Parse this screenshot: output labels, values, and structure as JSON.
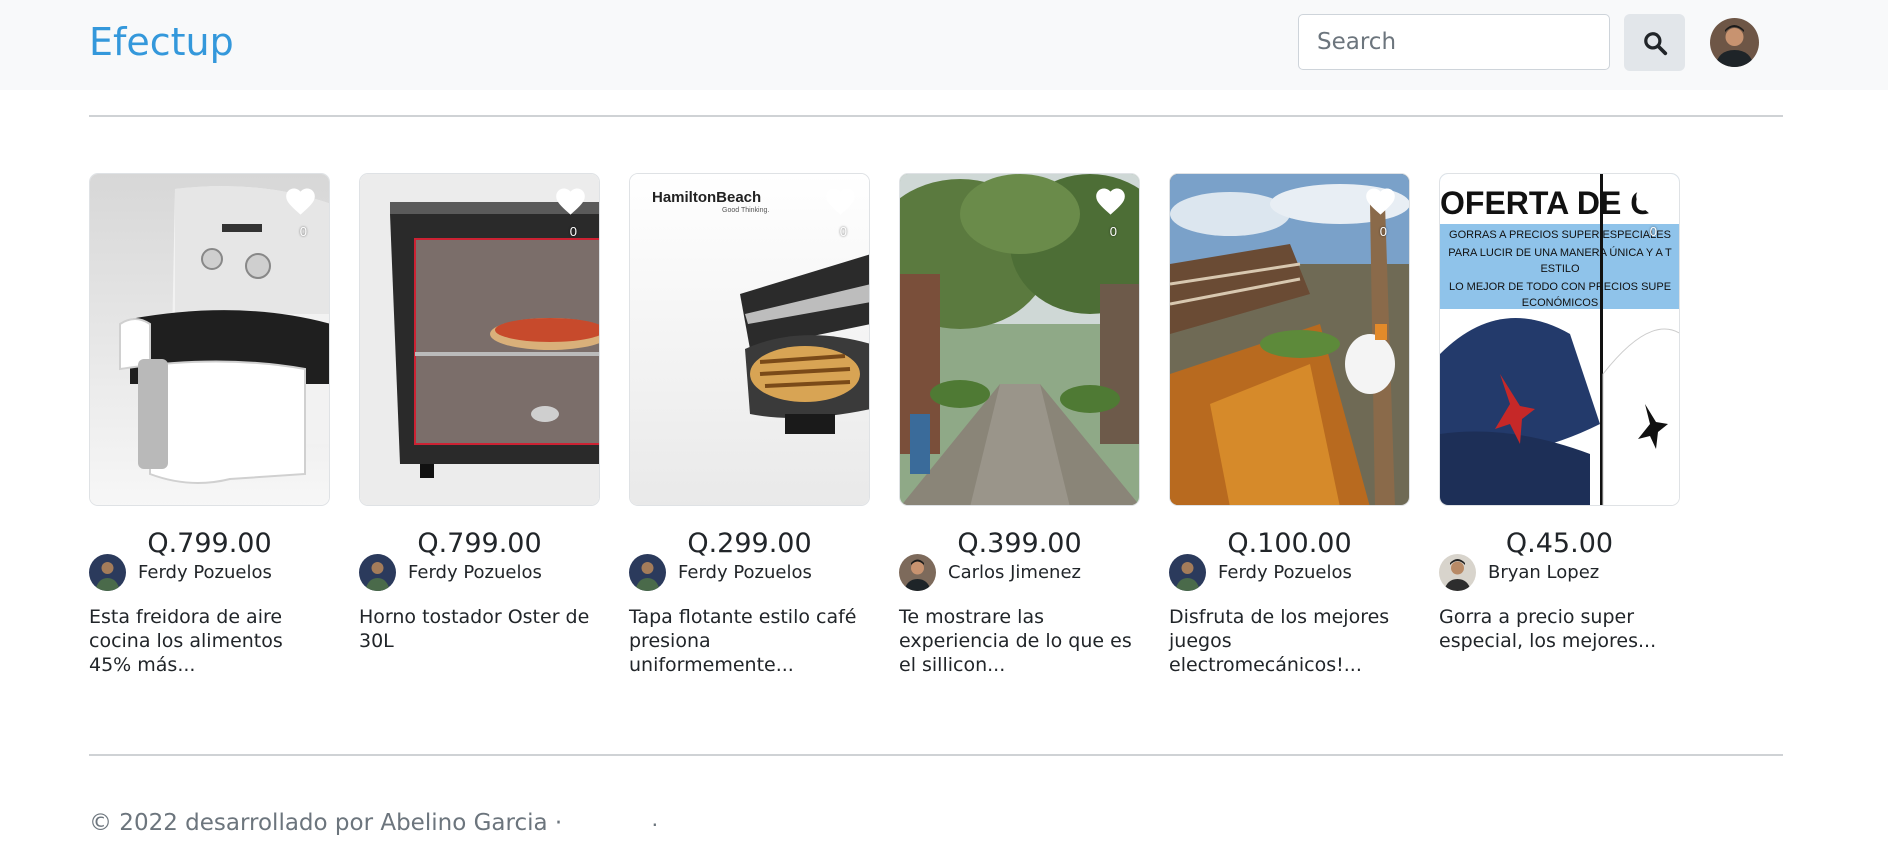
{
  "navbar": {
    "brand": "Efectup",
    "search_placeholder": "Search",
    "search_icon": "search-icon",
    "avatar_icon": "user-avatar"
  },
  "products": [
    {
      "price": "Q.799.00",
      "seller": "Ferdy Pozuelos",
      "description": "Esta freidora de aire cocina los alimentos 45% más...",
      "likes": "0",
      "image": "air-fryer"
    },
    {
      "price": "Q.799.00",
      "seller": "Ferdy Pozuelos",
      "description": "Horno tostador Oster de 30L",
      "likes": "0",
      "image": "toaster-oven"
    },
    {
      "price": "Q.299.00",
      "seller": "Ferdy Pozuelos",
      "description": "Tapa flotante estilo café presiona uniformemente...",
      "likes": "0",
      "image": "panini-press",
      "image_text": "HamiltonBeach",
      "image_subtext": "Good Thinking."
    },
    {
      "price": "Q.399.00",
      "seller": "Carlos Jimenez",
      "description": "Te mostrare las experiencia de lo que es el sillicon...",
      "likes": "0",
      "image": "street-photo"
    },
    {
      "price": "Q.100.00",
      "seller": "Ferdy Pozuelos",
      "description": "Disfruta de los mejores juegos electromecánicos!...",
      "likes": "0",
      "image": "water-ride-photo"
    },
    {
      "price": "Q.45.00",
      "seller": "Bryan Lopez",
      "description": "Gorra a precio super especial, los mejores...",
      "likes": "0",
      "image": "caps-offer",
      "image_title": "OFERTA DE G",
      "image_lines": [
        "GORRAS A PRECIOS SUPER ESPECIALES",
        "PARA LUCIR DE UNA MANERA ÚNICA Y A T",
        "ESTILO",
        "LO MEJOR DE TODO CON PRECIOS SUPE",
        "ECONÓMICOS"
      ]
    }
  ],
  "footer": {
    "text": "© 2022 desarrollado por Abelino Garcia ·",
    "dot": "·"
  },
  "colors": {
    "brand": "#3498db",
    "navbar_bg": "#f8f9fa",
    "text": "#212529",
    "muted": "#6c757d"
  }
}
